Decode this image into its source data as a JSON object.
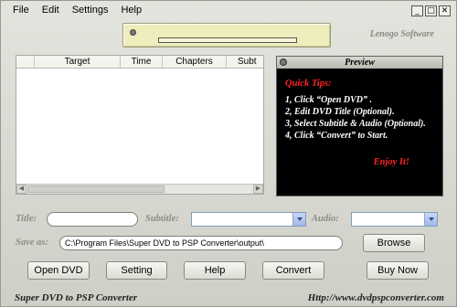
{
  "menu": {
    "items": [
      "File",
      "Edit",
      "Settings",
      "Help"
    ]
  },
  "window_controls": {
    "minimize": "_",
    "maximize": "□",
    "close": "✕"
  },
  "status": {
    "brand": "Lenogo Software"
  },
  "list": {
    "columns": [
      "",
      "Target",
      "Time",
      "Chapters",
      "Subt"
    ]
  },
  "preview": {
    "title": "Preview",
    "tips_title": "Quick Tips:",
    "tips": [
      "1, Click “Open DVD” .",
      "2, Edit DVD Title (Optional).",
      "3, Select Subtitle & Audio (Optional).",
      "4, Click “Convert” to Start."
    ],
    "enjoy": "Enjoy It!"
  },
  "form": {
    "title_label": "Title:",
    "title_value": "",
    "subtitle_label": "Subtitle:",
    "subtitle_value": "",
    "audio_label": "Audio:",
    "audio_value": "",
    "saveas_label": "Save as:",
    "saveas_value": "C:\\Program Files\\Super DVD to PSP Converter\\output\\",
    "browse_label": "Browse"
  },
  "buttons": {
    "open_dvd": "Open DVD",
    "setting": "Setting",
    "help": "Help",
    "convert": "Convert",
    "buy_now": "Buy Now"
  },
  "footer": {
    "app_name": "Super DVD to PSP Converter",
    "url": "Http://www.dvdpspconverter.com"
  }
}
